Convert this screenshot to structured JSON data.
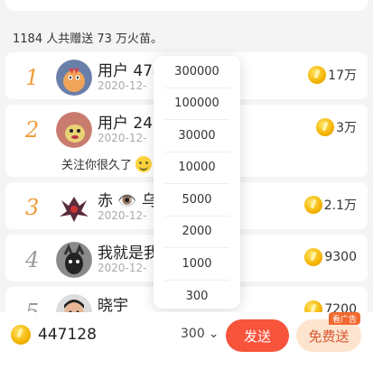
{
  "summary": "1184 人共赠送 73 万火苗。",
  "rows": [
    {
      "rank": "1",
      "name": "用户 474",
      "date": "2020-12-",
      "gift": "17万"
    },
    {
      "rank": "2",
      "name": "用户 24",
      "date": "2020-12-",
      "gift": "3万",
      "message": "关注你很久了"
    },
    {
      "rank": "3",
      "name": "赤 👁️ 乌",
      "date": "2020-12-",
      "gift": "2.1万"
    },
    {
      "rank": "4",
      "name": "我就是我",
      "date": "2020-12-",
      "gift": "9300"
    },
    {
      "rank": "5",
      "name": "晓宇",
      "date": "",
      "gift": "7200"
    }
  ],
  "dropdown": {
    "options": [
      "300000",
      "100000",
      "30000",
      "10000",
      "5000",
      "2000",
      "1000",
      "300"
    ]
  },
  "bottom": {
    "balance": "447128",
    "selected_amount": "300",
    "chevron": "⌄",
    "send_label": "发送",
    "free_send_label": "免费送",
    "ad_badge": "看广告"
  },
  "colors": {
    "rank_gold": "#ef9b3a",
    "rank_grey": "#9a9a9a",
    "send_button": "#f8533b",
    "free_button_bg": "#fde4cf",
    "ad_badge": "#f0692f"
  },
  "icons": {
    "coin": "coin-icon",
    "smiley": "smiley-emoji-icon",
    "chevron": "chevron-down-icon"
  }
}
